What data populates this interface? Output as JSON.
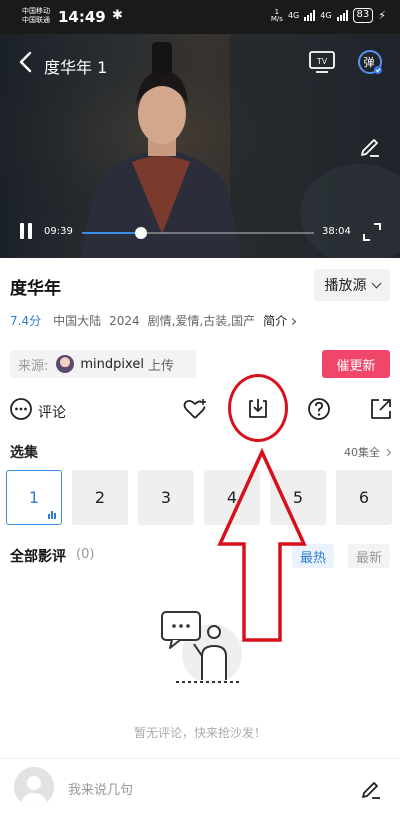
{
  "status_bar": {
    "carrier1": "中国移动",
    "carrier2": "中国联通",
    "time": "14:49",
    "bluetooth_icon": "bluetooth-icon",
    "net_speed_value": "1",
    "net_speed_unit": "M/s",
    "net_type1": "4G",
    "net_type2": "4G",
    "battery": "83"
  },
  "player": {
    "title": "度华年 1",
    "current_time": "09:39",
    "total_time": "38:04",
    "progress_fraction": 0.253,
    "cast_label": "TV",
    "danmaku_label": "弹"
  },
  "show": {
    "title": "度华年",
    "source_button": "播放源",
    "rating": "7.4分",
    "region": "中国大陆",
    "year": "2024",
    "genres": "剧情,爱情,古装,国产",
    "intro_link": "简介",
    "source_label": "来源:",
    "uploader": "mindpixel",
    "upload_suffix": "上传",
    "urge_button": "催更新"
  },
  "actions": {
    "comment_label": "评论"
  },
  "episodes": {
    "heading": "选集",
    "count_label": "40集全",
    "items": [
      "1",
      "2",
      "3",
      "4",
      "5",
      "6"
    ],
    "active_index": 0
  },
  "reviews": {
    "heading": "全部影评",
    "count": "(0)",
    "sort_hot": "最热",
    "sort_new": "最新",
    "empty_text": "暂无评论，快来抢沙发！"
  },
  "bottom_bar": {
    "placeholder": "我来说几句"
  },
  "colors": {
    "accent": "#2f7bd6",
    "urge": "#f0466a",
    "annotation": "#d8101d"
  }
}
